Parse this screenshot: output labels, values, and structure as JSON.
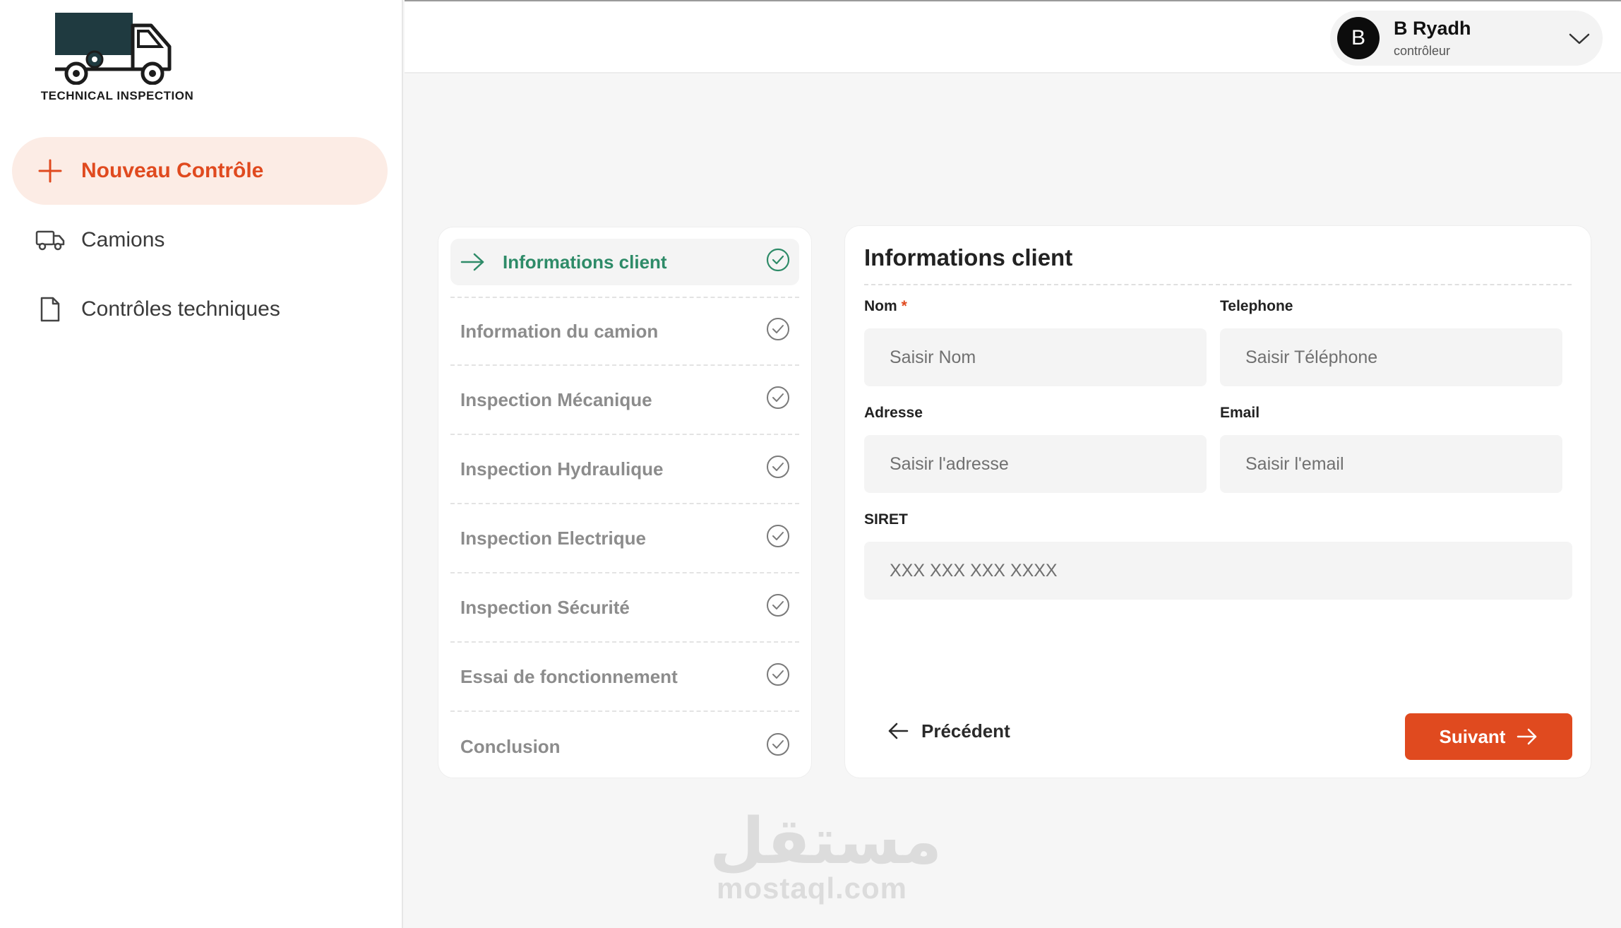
{
  "brand": {
    "logo_text": "TECHNICAL INSPECTION"
  },
  "sidebar": {
    "items": [
      {
        "label": "Nouveau Contrôle",
        "icon": "plus-icon",
        "active": true
      },
      {
        "label": "Camions",
        "icon": "truck-icon",
        "active": false
      },
      {
        "label": "Contrôles techniques",
        "icon": "document-icon",
        "active": false
      }
    ]
  },
  "user": {
    "initial": "B",
    "name": "B Ryadh",
    "role": "contrôleur"
  },
  "steps": [
    {
      "label": "Informations client",
      "active": true
    },
    {
      "label": "Information du camion",
      "active": false
    },
    {
      "label": "Inspection Mécanique",
      "active": false
    },
    {
      "label": "Inspection Hydraulique",
      "active": false
    },
    {
      "label": "Inspection Electrique",
      "active": false
    },
    {
      "label": "Inspection Sécurité",
      "active": false
    },
    {
      "label": "Essai de fonctionnement",
      "active": false
    },
    {
      "label": "Conclusion",
      "active": false
    }
  ],
  "form": {
    "title": "Informations client",
    "nom": {
      "label": "Nom",
      "required_mark": "*",
      "placeholder": "Saisir Nom",
      "value": ""
    },
    "telephone": {
      "label": "Telephone",
      "placeholder": "Saisir Téléphone",
      "value": ""
    },
    "adresse": {
      "label": "Adresse",
      "placeholder": "Saisir l'adresse",
      "value": ""
    },
    "email": {
      "label": "Email",
      "placeholder": "Saisir l'email",
      "value": ""
    },
    "siret": {
      "label": "SIRET",
      "placeholder": "XXX XXX XXX XXXX",
      "value": ""
    },
    "prev_label": "Précédent",
    "next_label": "Suivant"
  },
  "watermark": {
    "arabic": "مستقل",
    "latin": "mostaql.com"
  },
  "colors": {
    "accent": "#e04a1f",
    "accent_soft": "#fcece5",
    "success": "#2e8b68",
    "logo_dark": "#1f3a40"
  }
}
